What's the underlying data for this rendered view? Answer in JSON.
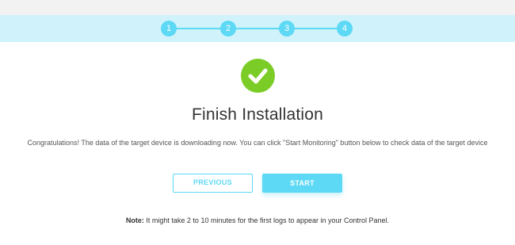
{
  "stepper": {
    "steps": [
      "1",
      "2",
      "3",
      "4"
    ],
    "active_color": "#5dd8f5",
    "band_color": "#d0f3fb"
  },
  "status": {
    "icon": "checkmark-icon",
    "icon_color": "#7ccc28"
  },
  "page": {
    "title": "Finish Installation",
    "message": "Congratulations! The data of the target device is downloading now. You can click \"Start Monitoring\" button below to check data of the target device"
  },
  "buttons": {
    "previous_label": "PREVIOUS",
    "start_label": "START"
  },
  "note": {
    "label": "Note:",
    "text": " It might take 2 to 10 minutes for the first logs to appear in your Control Panel."
  }
}
